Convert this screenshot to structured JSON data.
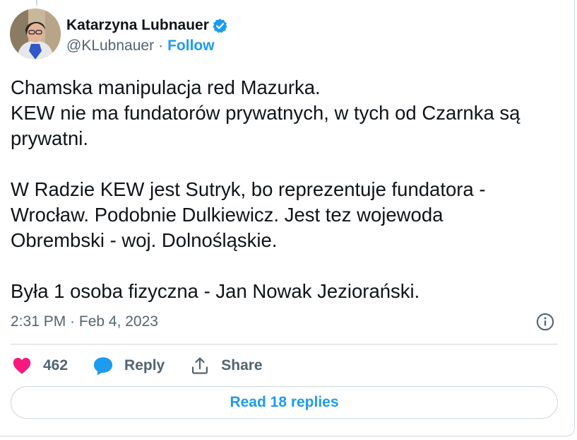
{
  "author": {
    "display_name": "Katarzyna Lubnauer",
    "handle": "@KLubnauer",
    "separator": "·",
    "follow_label": "Follow"
  },
  "tweet": {
    "lines": [
      "Chamska manipulacja red Mazurka.",
      "KEW nie ma fundatorów prywatnych, w tych od Czarnka są",
      "prywatni.",
      "",
      "W Radzie KEW jest Sutryk, bo reprezentuje fundatora -",
      "Wrocław. Podobnie Dulkiewicz. Jest tez wojewoda",
      "Obrembski - woj. Dolnośląskie.",
      "",
      "Była 1 osoba fizyczna - Jan Nowak Jeziorański."
    ],
    "timestamp": "2:31 PM · Feb 4, 2023"
  },
  "actions": {
    "like_count": "462",
    "reply_label": "Reply",
    "share_label": "Share"
  },
  "read_replies_label": "Read 18 replies",
  "colors": {
    "accent": "#1d9bf0",
    "like": "#f91880",
    "muted": "#536471",
    "text": "#0f1419",
    "border": "#cfd9de"
  },
  "icons": {
    "verified": "verified-badge-icon",
    "info": "info-icon",
    "like": "heart-icon",
    "reply": "speech-bubble-icon",
    "share": "share-upload-icon"
  }
}
